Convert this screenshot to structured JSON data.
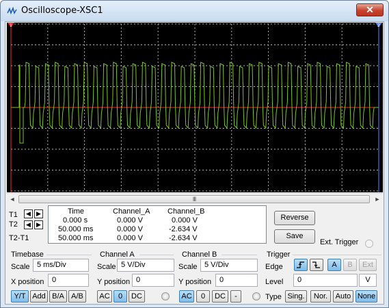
{
  "window": {
    "title": "Oscilloscope-XSC1",
    "close_glyph": "✕"
  },
  "scope": {
    "background": "#000000",
    "grid_color": "#b0b0b0",
    "channel_a_color": "#ff2a2a",
    "channel_b_color": "#7cc520",
    "cursor1_color": "#ff2a2a",
    "cursor2_color": "#4a8cff",
    "cursor1_label": "1",
    "cursor2_label": "2"
  },
  "scrollbar": {
    "left": "◄",
    "right": "►",
    "grip": "III"
  },
  "cursors": {
    "t1": "T1",
    "t2": "T2",
    "t2_t1": "T2-T1",
    "left_arrow": "◀",
    "right_arrow": "▶"
  },
  "readout": {
    "headers": [
      "Time",
      "Channel_A",
      "Channel_B"
    ],
    "rows": [
      [
        "0.000 s",
        "0.000 V",
        "0.000 V"
      ],
      [
        "50.000 ms",
        "0.000 V",
        "-2.634 V"
      ],
      [
        "50.000 ms",
        "0.000 V",
        "-2.634 V"
      ]
    ]
  },
  "buttons": {
    "reverse": "Reverse",
    "save": "Save",
    "ext_trigger": "Ext. Trigger"
  },
  "timebase": {
    "title": "Timebase",
    "scale_label": "Scale",
    "scale_value": "5 ms/Div",
    "xpos_label": "X position",
    "xpos_value": "0",
    "modes": [
      "Y/T",
      "Add",
      "B/A",
      "A/B"
    ]
  },
  "channel_a": {
    "title": "Channel A",
    "scale_label": "Scale",
    "scale_value": "5  V/Div",
    "ypos_label": "Y position",
    "ypos_value": "0",
    "coupling": [
      "AC",
      "0",
      "DC"
    ]
  },
  "channel_b": {
    "title": "Channel B",
    "scale_label": "Scale",
    "scale_value": "5  V/Div",
    "ypos_label": "Y position",
    "ypos_value": "0",
    "coupling": [
      "AC",
      "0",
      "DC",
      "-"
    ]
  },
  "trigger": {
    "title": "Trigger",
    "edge_label": "Edge",
    "edge_buttons": [
      "A",
      "B",
      "Ext"
    ],
    "level_label": "Level",
    "level_value": "0",
    "level_unit": "V",
    "type_label": "Type",
    "types": [
      "Sing.",
      "Nor.",
      "Auto",
      "None"
    ]
  }
}
